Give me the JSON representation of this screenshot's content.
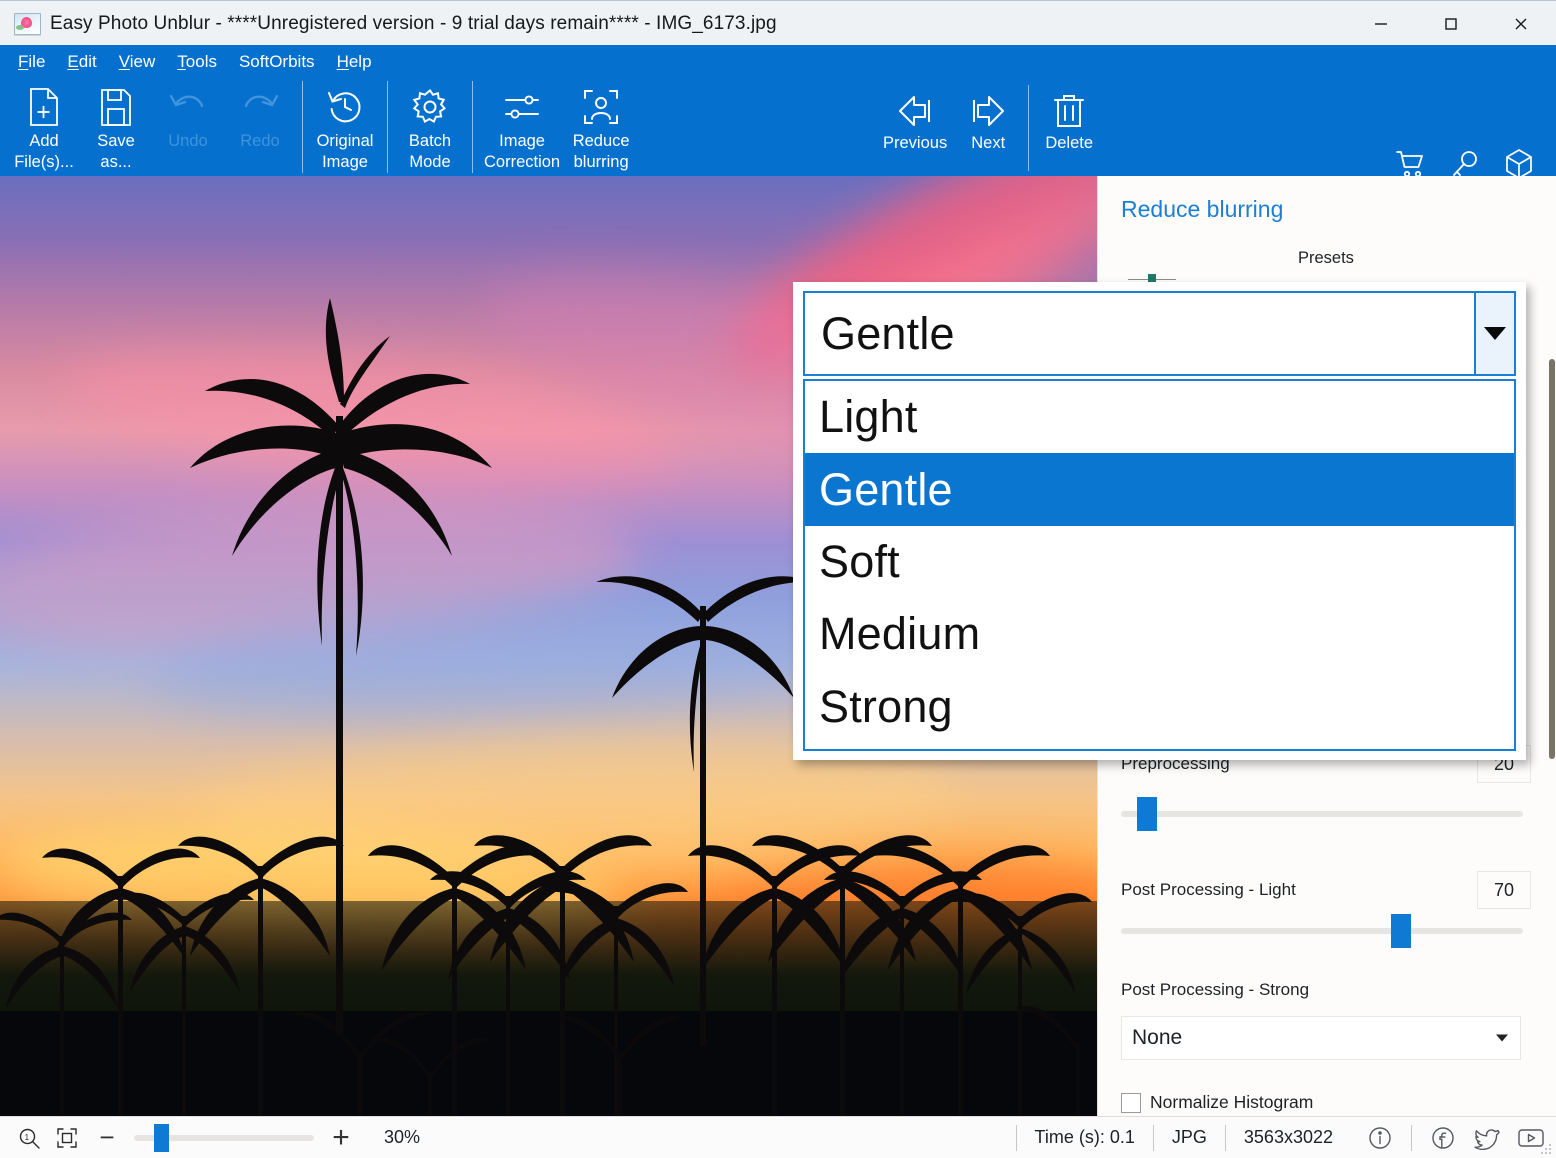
{
  "window": {
    "title": "Easy Photo Unblur - ****Unregistered version - 9 trial days remain**** - IMG_6173.jpg",
    "app_icon": "photo-flower-icon",
    "minimize_label": "Minimize",
    "maximize_label": "Maximize",
    "close_label": "Close"
  },
  "menu": {
    "items": [
      {
        "label": "File",
        "accesskey": "F"
      },
      {
        "label": "Edit",
        "accesskey": "E"
      },
      {
        "label": "View",
        "accesskey": "V"
      },
      {
        "label": "Tools",
        "accesskey": "T"
      },
      {
        "label": "SoftOrbits",
        "accesskey": ""
      },
      {
        "label": "Help",
        "accesskey": "H"
      }
    ]
  },
  "toolbar": {
    "add_files": "Add\nFile(s)...",
    "save_as": "Save\nas...",
    "undo": "Undo",
    "redo": "Redo",
    "original_image": "Original\nImage",
    "batch_mode": "Batch\nMode",
    "image_correction": "Image\nCorrection",
    "reduce_blurring": "Reduce\nblurring",
    "previous": "Previous",
    "next": "Next",
    "delete": "Delete",
    "cart_icon": "shopping-cart-icon",
    "key_icon": "key-icon",
    "box_icon": "box-icon",
    "accent_color": "#0570ce",
    "disabled_color": "#3f94dc"
  },
  "panel": {
    "title": "Reduce blurring",
    "presets_label": "Presets",
    "preprocessing": {
      "label": "Preprocessing",
      "value": "20",
      "slider_percent": 6
    },
    "post_processing_light": {
      "label": "Post Processing - Light",
      "value": "70",
      "slider_percent": 70
    },
    "post_processing_strong": {
      "label": "Post Processing - Strong",
      "value": "None"
    },
    "normalize_histogram": {
      "label": "Normalize Histogram",
      "checked": false
    }
  },
  "preset_dropdown": {
    "selected": "Gentle",
    "expanded": true,
    "caret_icon": "chevron-down-icon",
    "options": [
      {
        "label": "Light",
        "selected": false
      },
      {
        "label": "Gentle",
        "selected": true
      },
      {
        "label": "Soft",
        "selected": false
      },
      {
        "label": "Medium",
        "selected": false
      },
      {
        "label": "Strong",
        "selected": false
      }
    ],
    "highlight_color": "#0b76d0",
    "border_color": "#1a7fd4"
  },
  "statusbar": {
    "zoom_icon": "zoom-one-to-one-icon",
    "fit_icon": "fit-to-screen-icon",
    "minus": "−",
    "plus": "+",
    "zoom_percent": "30%",
    "time": "Time (s): 0.1",
    "format": "JPG",
    "dimensions": "3563x3022",
    "info_icon": "info-icon",
    "facebook_icon": "facebook-icon",
    "twitter_icon": "twitter-icon",
    "youtube_icon": "youtube-icon"
  },
  "canvas": {
    "image_description": "Tropical sunset with palm tree silhouettes",
    "alt": "IMG_6173.jpg"
  }
}
